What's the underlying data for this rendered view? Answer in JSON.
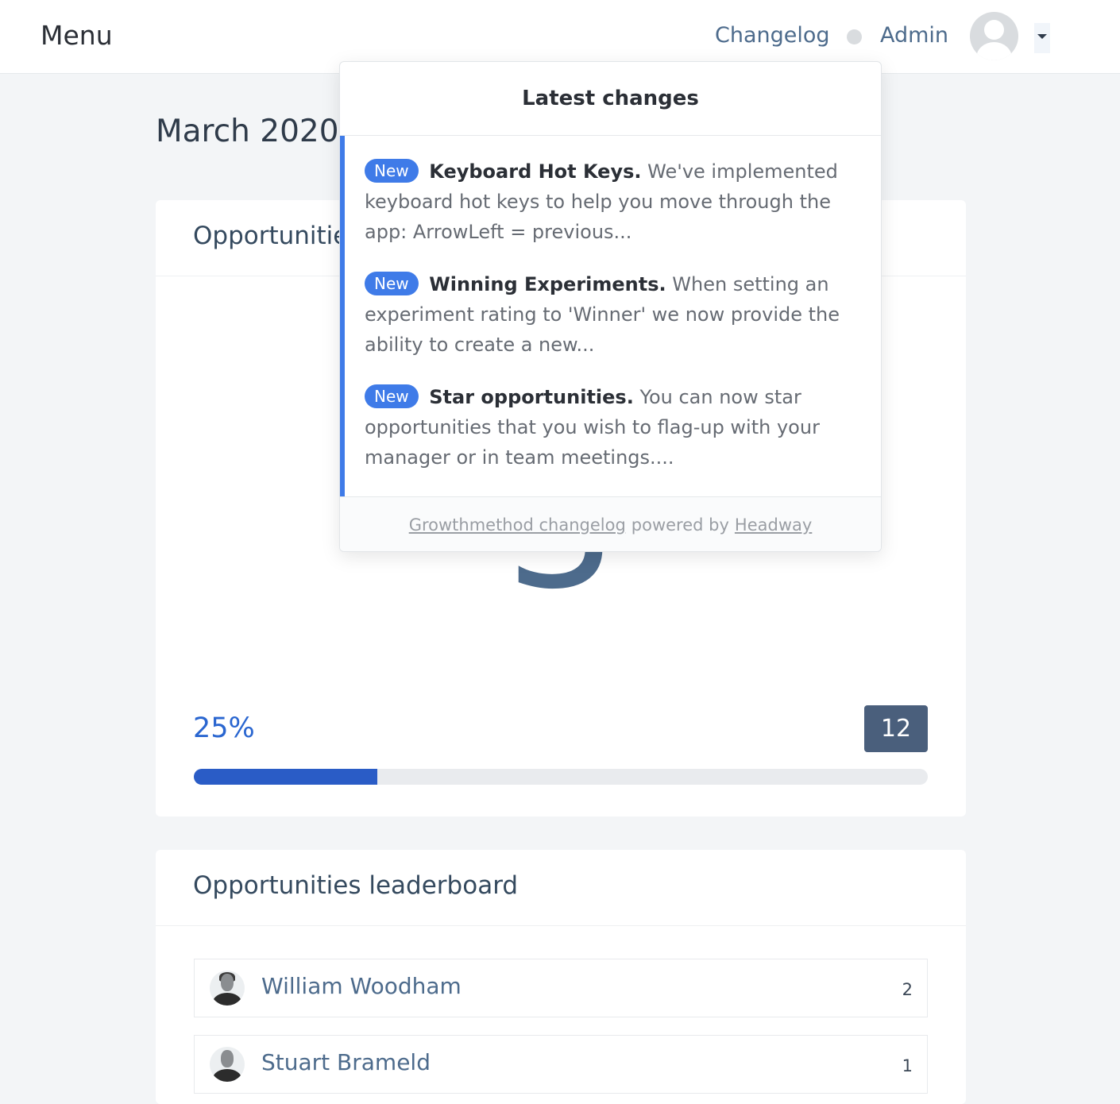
{
  "topbar": {
    "menu_label": "Menu",
    "changelog_link": "Changelog",
    "admin_link": "Admin"
  },
  "page": {
    "title": "March 2020"
  },
  "progress_card": {
    "title": "Opportunities",
    "big_number": "3",
    "percent_label": "25%",
    "percent_value": 0.25,
    "target": "12"
  },
  "leaderboard": {
    "title": "Opportunities leaderboard",
    "rows": [
      {
        "name": "William Woodham",
        "count": "2"
      },
      {
        "name": "Stuart Brameld",
        "count": "1"
      }
    ]
  },
  "changelog_popup": {
    "header": "Latest changes",
    "items": [
      {
        "badge": "New",
        "title": "Keyboard Hot Keys.",
        "text": "We've implemented keyboard hot keys to help you move through the app: ArrowLeft = previous..."
      },
      {
        "badge": "New",
        "title": "Winning Experiments.",
        "text": "When setting an experiment rating to 'Winner' we now provide the ability to create a new..."
      },
      {
        "badge": "New",
        "title": "Star opportunities.",
        "text": "You can now star opportunities that you wish to flag-up with your manager or in team meetings...."
      }
    ],
    "footer": {
      "link1": "Growthmethod changelog",
      "middle": "powered by",
      "link2": "Headway"
    }
  },
  "colors": {
    "accent": "#3f7be8",
    "progress_fill": "#2a5cc6",
    "badge_dark": "#4a5f7c"
  }
}
